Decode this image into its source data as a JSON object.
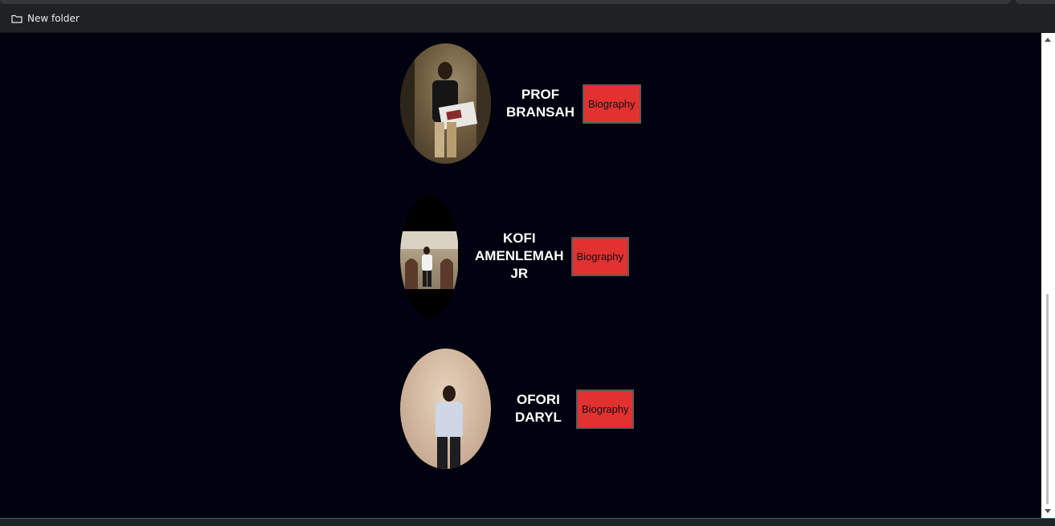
{
  "bookmarks_bar": {
    "items": [
      {
        "label": "New folder",
        "icon": "folder-icon"
      }
    ]
  },
  "people": [
    {
      "name_lines": [
        "PROF",
        "BRANSAH"
      ],
      "button_label": "Biography",
      "photo_icon": "portrait-photo"
    },
    {
      "name_lines": [
        "KOFI",
        "AMENLEMAH",
        "JR"
      ],
      "button_label": "Biography",
      "photo_icon": "portrait-photo"
    },
    {
      "name_lines": [
        "OFORI",
        "DARYL"
      ],
      "button_label": "Biography",
      "photo_icon": "portrait-photo"
    }
  ],
  "colors": {
    "page_background": "#01020f",
    "button_background": "#e23131",
    "name_text": "#ffffff"
  }
}
